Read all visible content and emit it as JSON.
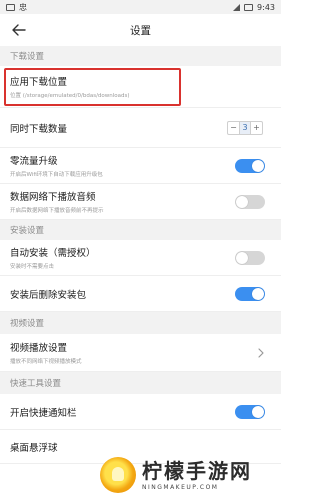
{
  "statusbar": {
    "carrier_icon_text": "忠",
    "time": "9:43"
  },
  "header": {
    "title": "设置"
  },
  "sections": {
    "download": "下载设置",
    "install": "安装设置",
    "video": "视频设置",
    "tools": "快速工具设置"
  },
  "rows": {
    "download_location": {
      "label": "应用下载位置",
      "sub": "位置 (/storage/emulated/0/bdas/downloads)"
    },
    "concurrent_downloads": {
      "label": "同时下载数量",
      "minus": "−",
      "value": "3",
      "plus": "+"
    },
    "zero_data_upgrade": {
      "label": "零流量升级",
      "sub": "开启后Wifi环境下自动下载应用升级包",
      "toggle": "on"
    },
    "mobile_play_audio": {
      "label": "数据网络下播放音频",
      "sub": "开启后数据网络下播放音频前不再提示",
      "toggle": "off"
    },
    "auto_install": {
      "label": "自动安装（需授权）",
      "sub": "安装时不需要点击",
      "toggle": "off"
    },
    "delete_after_install": {
      "label": "安装后删除安装包",
      "toggle": "on"
    },
    "video_playback": {
      "label": "视频播放设置",
      "sub": "播放不同网络下视频播放模式"
    },
    "quick_notification": {
      "label": "开启快捷通知栏",
      "toggle": "on"
    },
    "floating_ball": {
      "label": "桌面悬浮球"
    }
  },
  "watermark": {
    "title": "柠檬手游网",
    "subtitle": "NINGMAKEUP.COM"
  },
  "colors": {
    "accent": "#3b8ff0",
    "highlight_border": "#d9322e",
    "section_bg": "#f2f2f2"
  }
}
